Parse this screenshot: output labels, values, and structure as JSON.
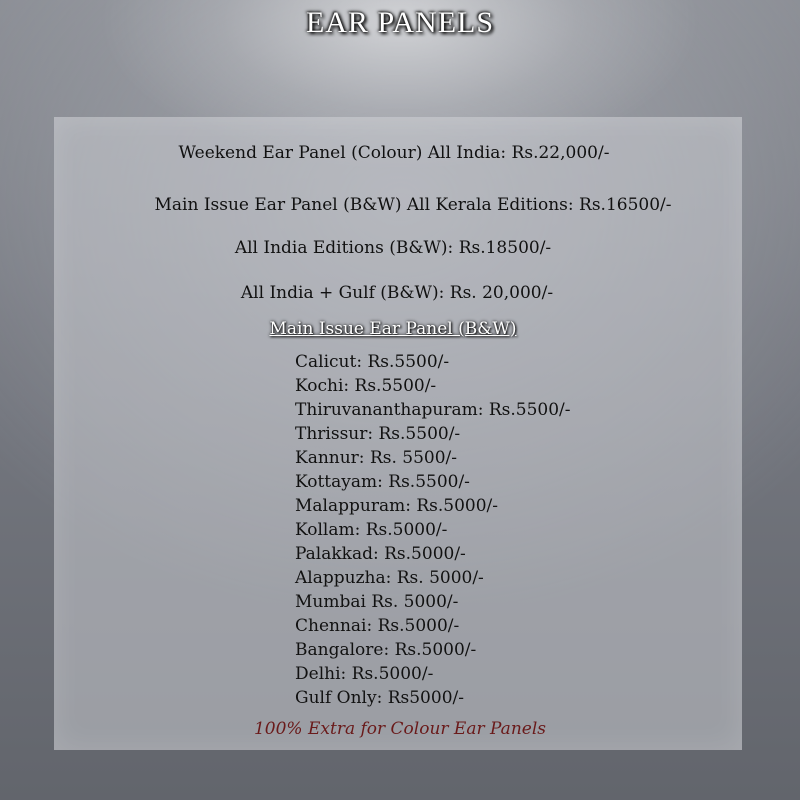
{
  "title": "EAR PANELS",
  "rates": [
    "Weekend Ear Panel (Colour) All India: Rs.22,000/-",
    "Main Issue Ear Panel (B&W) All Kerala Editions: Rs.16500/-",
    "All India Editions (B&W): Rs.18500/-",
    "All India + Gulf (B&W): Rs. 20,000/-"
  ],
  "subheading": "Main Issue Ear Panel (B&W)",
  "cities": [
    "Calicut: Rs.5500/-",
    "Kochi: Rs.5500/-",
    "Thiruvananthapuram: Rs.5500/-",
    "Thrissur: Rs.5500/-",
    "Kannur: Rs. 5500/-",
    "Kottayam: Rs.5500/-",
    "Malappuram: Rs.5000/-",
    "Kollam: Rs.5000/-",
    "Palakkad: Rs.5000/-",
    "Alappuzha: Rs. 5000/-",
    "Mumbai Rs. 5000/-",
    "Chennai: Rs.5000/-",
    "Bangalore: Rs.5000/-",
    "Delhi: Rs.5000/-",
    "Gulf Only: Rs5000/-"
  ],
  "footer": "100% Extra for Colour Ear Panels",
  "colors": {
    "footer_text": "#6a1a1a",
    "title_text": "#ffffff"
  }
}
